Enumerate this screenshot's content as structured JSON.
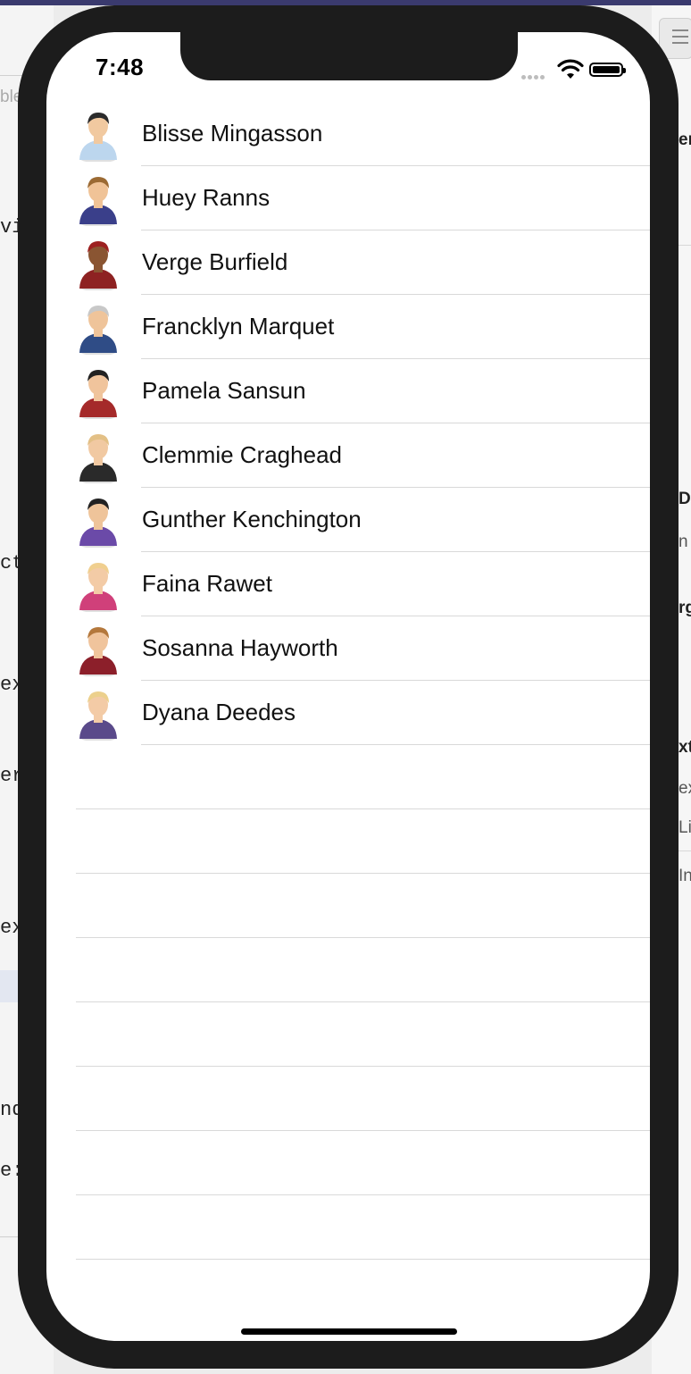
{
  "background_ide": {
    "left_fragments": [
      "ble",
      "vi",
      "ct",
      "ex",
      "er",
      "ex",
      "nd",
      "e:"
    ],
    "right_fragments": [
      "en",
      "D",
      "n",
      "rg",
      "xt",
      "ex",
      "Li",
      "In"
    ]
  },
  "status_bar": {
    "time": "7:48"
  },
  "contacts": [
    {
      "name": "Blisse Mingasson",
      "avatar": "man-light-blue-shirt-icon",
      "hair": "#2b2b2b",
      "skin": "#f1c9a0",
      "shirt": "#bcd6ee"
    },
    {
      "name": "Huey Ranns",
      "avatar": "man-green-scarf-icon",
      "hair": "#9b6a33",
      "skin": "#f0c397",
      "shirt": "#3a3f8a"
    },
    {
      "name": "Verge Burfield",
      "avatar": "man-red-cap-icon",
      "hair": "#9d2020",
      "skin": "#8a5532",
      "shirt": "#8e2222"
    },
    {
      "name": "Francklyn Marquet",
      "avatar": "man-gray-hair-icon",
      "hair": "#c8c8c8",
      "skin": "#efc49a",
      "shirt": "#2f4c86"
    },
    {
      "name": "Pamela Sansun",
      "avatar": "woman-dark-hair-icon",
      "hair": "#222222",
      "skin": "#f0c49c",
      "shirt": "#a52a2a"
    },
    {
      "name": "Clemmie Craghead",
      "avatar": "woman-blonde-black-top-icon",
      "hair": "#e3c086",
      "skin": "#f1c9a2",
      "shirt": "#2a2a2a"
    },
    {
      "name": "Gunther Kenchington",
      "avatar": "man-purple-vest-icon",
      "hair": "#222222",
      "skin": "#efc49a",
      "shirt": "#6b4aa8"
    },
    {
      "name": "Faina Rawet",
      "avatar": "woman-sunglasses-pink-icon",
      "hair": "#f0cf8f",
      "skin": "#f3cba6",
      "shirt": "#d0407a"
    },
    {
      "name": "Sosanna Hayworth",
      "avatar": "woman-brown-hair-icon",
      "hair": "#b4783c",
      "skin": "#f0c49c",
      "shirt": "#8c1f2a"
    },
    {
      "name": "Dyana Deedes",
      "avatar": "woman-blonde-purple-icon",
      "hair": "#ecd08c",
      "skin": "#f3cba6",
      "shirt": "#5a4a8a"
    }
  ],
  "empty_rows": 8
}
